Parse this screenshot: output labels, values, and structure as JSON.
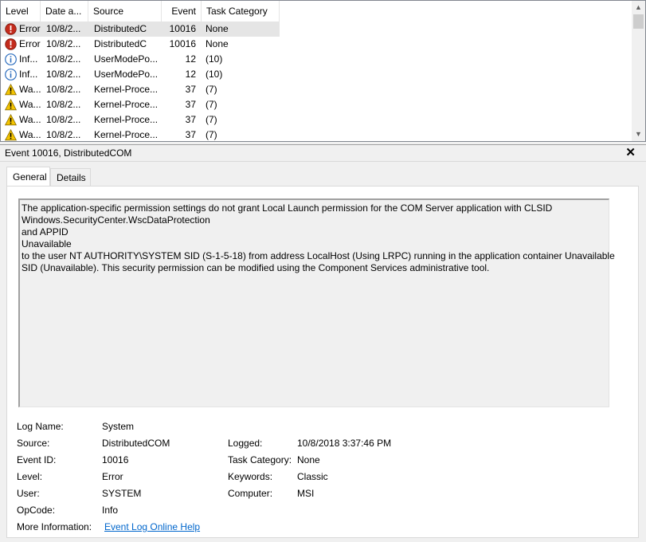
{
  "columns": {
    "level": "Level",
    "date": "Date a...",
    "source": "Source",
    "event": "Event",
    "task": "Task Category"
  },
  "rows": [
    {
      "icon": "error-icon",
      "level": "Error",
      "date": "10/8/2...",
      "source": "DistributedC",
      "event": "10016",
      "task": "None"
    },
    {
      "icon": "error-icon",
      "level": "Error",
      "date": "10/8/2...",
      "source": "DistributedC",
      "event": "10016",
      "task": "None"
    },
    {
      "icon": "info-icon",
      "level": "Inf...",
      "date": "10/8/2...",
      "source": "UserModePo...",
      "event": "12",
      "task": "(10)"
    },
    {
      "icon": "info-icon",
      "level": "Inf...",
      "date": "10/8/2...",
      "source": "UserModePo...",
      "event": "12",
      "task": "(10)"
    },
    {
      "icon": "warning-icon",
      "level": "Wa...",
      "date": "10/8/2...",
      "source": "Kernel-Proce...",
      "event": "37",
      "task": "(7)"
    },
    {
      "icon": "warning-icon",
      "level": "Wa...",
      "date": "10/8/2...",
      "source": "Kernel-Proce...",
      "event": "37",
      "task": "(7)"
    },
    {
      "icon": "warning-icon",
      "level": "Wa...",
      "date": "10/8/2...",
      "source": "Kernel-Proce...",
      "event": "37",
      "task": "(7)"
    },
    {
      "icon": "warning-icon",
      "level": "Wa...",
      "date": "10/8/2...",
      "source": "Kernel-Proce...",
      "event": "37",
      "task": "(7)"
    }
  ],
  "detail": {
    "title": "Event 10016, DistributedCOM",
    "close": "✕",
    "tabs": {
      "general": "General",
      "details": "Details"
    },
    "description": [
      "The application-specific permission settings do not grant Local Launch permission for the COM Server application with CLSID",
      "Windows.SecurityCenter.WscDataProtection",
      " and APPID",
      "Unavailable",
      " to the user NT AUTHORITY\\SYSTEM SID (S-1-5-18) from address LocalHost (Using LRPC) running in the application container Unavailable",
      "SID (Unavailable). This security permission can be modified using the Component Services administrative tool."
    ],
    "labels": {
      "log_name": "Log Name:",
      "source": "Source:",
      "event_id": "Event ID:",
      "level": "Level:",
      "user": "User:",
      "opcode": "OpCode:",
      "more_info": "More Information:",
      "logged": "Logged:",
      "task_category": "Task Category:",
      "keywords": "Keywords:",
      "computer": "Computer:"
    },
    "values": {
      "log_name": "System",
      "source": "DistributedCOM",
      "event_id": "10016",
      "level": "Error",
      "user": "SYSTEM",
      "opcode": "Info",
      "more_info": "Event Log Online Help",
      "logged": "10/8/2018 3:37:46 PM",
      "task_category": "None",
      "keywords": "Classic",
      "computer": "MSI"
    }
  },
  "colors": {
    "error": "#c42b1c",
    "info": "#2f6fbf",
    "warning": "#f4c400",
    "link": "#0066cc"
  }
}
